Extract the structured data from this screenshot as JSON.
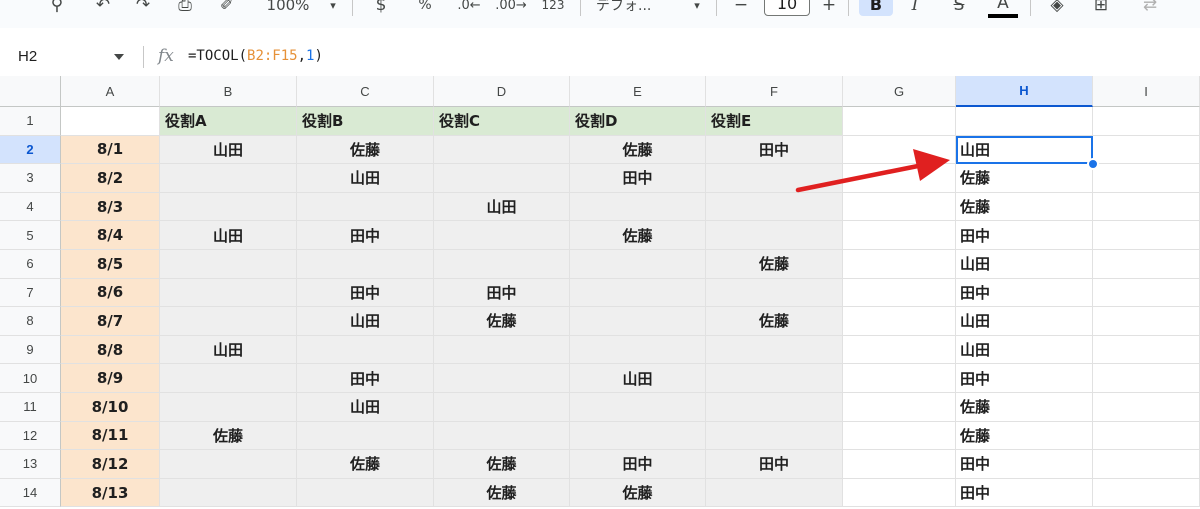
{
  "toolbar": {
    "zoom": "100%",
    "percent": "%",
    "number_format": "123",
    "font_name": "デフォ...",
    "font_size": "10",
    "minus": "−",
    "plus": "+",
    "bold": "B",
    "italic": "I",
    "strike": "S",
    "text_color": "A"
  },
  "formula_bar": {
    "name_box": "H2",
    "fx": "fx",
    "formula_prefix": "=TOCOL(",
    "formula_range": "B2:F15",
    "formula_sep": ",",
    "formula_arg": "1",
    "formula_suffix": ")"
  },
  "columns": [
    "A",
    "B",
    "C",
    "D",
    "E",
    "F",
    "G",
    "H",
    "I"
  ],
  "selected_column": "H",
  "selected_row": "2",
  "rows": [
    {
      "num": "1",
      "A": "",
      "B": "役割A",
      "C": "役割B",
      "D": "役割C",
      "E": "役割D",
      "F": "役割E",
      "G": "",
      "H": ""
    },
    {
      "num": "2",
      "A": "8/1",
      "B": "山田",
      "C": "佐藤",
      "D": "",
      "E": "佐藤",
      "F": "田中",
      "G": "",
      "H": "山田"
    },
    {
      "num": "3",
      "A": "8/2",
      "B": "",
      "C": "山田",
      "D": "",
      "E": "田中",
      "F": "",
      "G": "",
      "H": "佐藤"
    },
    {
      "num": "4",
      "A": "8/3",
      "B": "",
      "C": "",
      "D": "山田",
      "E": "",
      "F": "",
      "G": "",
      "H": "佐藤"
    },
    {
      "num": "5",
      "A": "8/4",
      "B": "山田",
      "C": "田中",
      "D": "",
      "E": "佐藤",
      "F": "",
      "G": "",
      "H": "田中"
    },
    {
      "num": "6",
      "A": "8/5",
      "B": "",
      "C": "",
      "D": "",
      "E": "",
      "F": "佐藤",
      "G": "",
      "H": "山田"
    },
    {
      "num": "7",
      "A": "8/6",
      "B": "",
      "C": "田中",
      "D": "田中",
      "E": "",
      "F": "",
      "G": "",
      "H": "田中"
    },
    {
      "num": "8",
      "A": "8/7",
      "B": "",
      "C": "山田",
      "D": "佐藤",
      "E": "",
      "F": "佐藤",
      "G": "",
      "H": "山田"
    },
    {
      "num": "9",
      "A": "8/8",
      "B": "山田",
      "C": "",
      "D": "",
      "E": "",
      "F": "",
      "G": "",
      "H": "山田"
    },
    {
      "num": "10",
      "A": "8/9",
      "B": "",
      "C": "田中",
      "D": "",
      "E": "山田",
      "F": "",
      "G": "",
      "H": "田中"
    },
    {
      "num": "11",
      "A": "8/10",
      "B": "",
      "C": "山田",
      "D": "",
      "E": "",
      "F": "",
      "G": "",
      "H": "佐藤"
    },
    {
      "num": "12",
      "A": "8/11",
      "B": "佐藤",
      "C": "",
      "D": "",
      "E": "",
      "F": "",
      "G": "",
      "H": "佐藤"
    },
    {
      "num": "13",
      "A": "8/12",
      "B": "",
      "C": "佐藤",
      "D": "佐藤",
      "E": "田中",
      "F": "田中",
      "G": "",
      "H": "田中"
    },
    {
      "num": "14",
      "A": "8/13",
      "B": "",
      "C": "",
      "D": "佐藤",
      "E": "佐藤",
      "F": "",
      "G": "",
      "H": "田中"
    }
  ],
  "annotation": {
    "arrow_color": "#e02020"
  }
}
